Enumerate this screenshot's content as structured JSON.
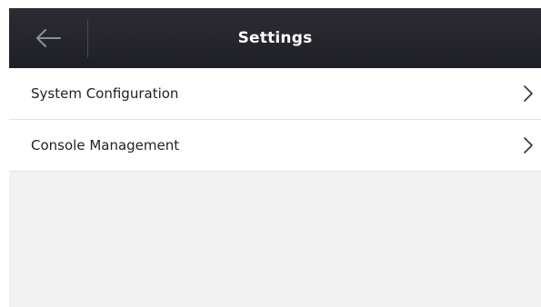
{
  "header": {
    "title": "Settings",
    "back_icon": "arrow-left-icon"
  },
  "menu": {
    "items": [
      {
        "label": "System Configuration",
        "icon": "chevron-right-icon"
      },
      {
        "label": "Console Management",
        "icon": "chevron-right-icon"
      }
    ]
  },
  "colors": {
    "header_bg": "#26272c",
    "header_text": "#ffffff",
    "list_bg": "#ffffff",
    "screen_bg": "#f2f2f2",
    "divider": "#e3e3e6"
  }
}
